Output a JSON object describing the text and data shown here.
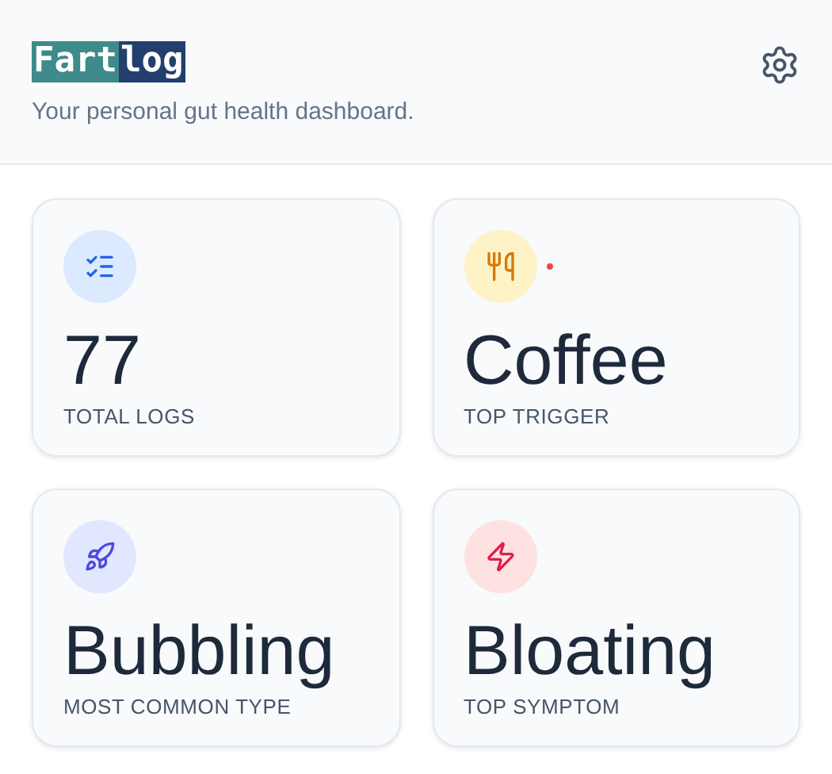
{
  "header": {
    "logo": [
      "Fart",
      "log"
    ],
    "subtitle": "Your personal gut health dashboard."
  },
  "stats": [
    {
      "kind": "checklist",
      "value": "77",
      "label": "TOTAL LOGS",
      "alert_dot": false
    },
    {
      "kind": "utensils",
      "value": "Coffee",
      "label": "TOP TRIGGER",
      "alert_dot": true
    },
    {
      "kind": "rocket",
      "value": "Bubbling",
      "label": "MOST COMMON TYPE",
      "alert_dot": false
    },
    {
      "kind": "zap",
      "value": "Bloating",
      "label": "TOP SYMPTOM",
      "alert_dot": false
    }
  ]
}
